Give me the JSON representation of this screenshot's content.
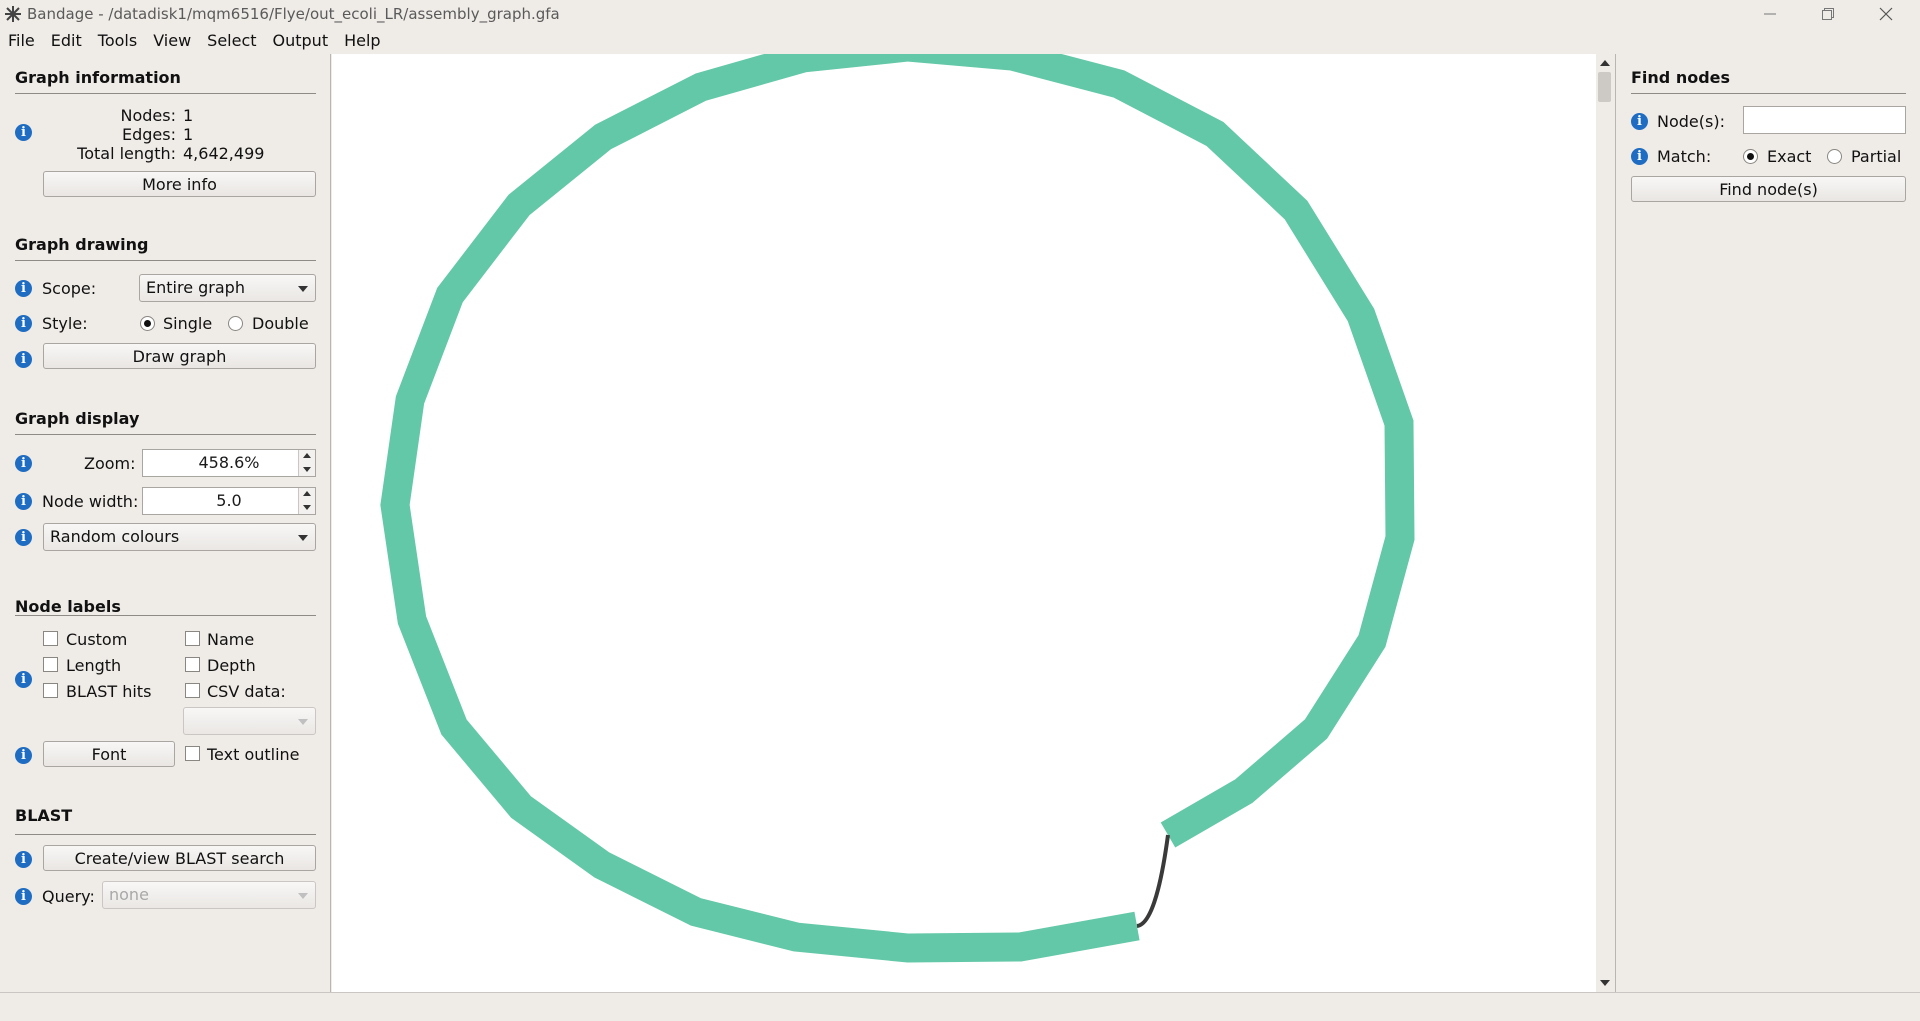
{
  "window": {
    "title": "Bandage - /datadisk1/mqm6516/Flye/out_ecoli_LR/assembly_graph.gfa"
  },
  "menu": [
    "File",
    "Edit",
    "Tools",
    "View",
    "Select",
    "Output",
    "Help"
  ],
  "graph_information": {
    "heading": "Graph information",
    "nodes_label": "Nodes:",
    "nodes_value": "1",
    "edges_label": "Edges:",
    "edges_value": "1",
    "total_length_label": "Total length:",
    "total_length_value": "4,642,499",
    "more_info_button": "More info"
  },
  "graph_drawing": {
    "heading": "Graph drawing",
    "scope_label": "Scope:",
    "scope_value": "Entire graph",
    "style_label": "Style:",
    "style_single": "Single",
    "style_double": "Double",
    "style_selected": "Single",
    "draw_button": "Draw graph"
  },
  "graph_display": {
    "heading": "Graph display",
    "zoom_label": "Zoom:",
    "zoom_value": "458.6%",
    "node_width_label": "Node width:",
    "node_width_value": "5.0",
    "colour_scheme": "Random colours"
  },
  "node_labels": {
    "heading": "Node labels",
    "custom": "Custom",
    "name": "Name",
    "length": "Length",
    "depth": "Depth",
    "blast_hits": "BLAST hits",
    "csv_data": "CSV data:",
    "font_button": "Font",
    "text_outline": "Text outline"
  },
  "blast": {
    "heading": "BLAST",
    "create_button": "Create/view BLAST search",
    "query_label": "Query:",
    "query_value": "none"
  },
  "find_nodes": {
    "heading": "Find nodes",
    "nodes_label": "Node(s):",
    "nodes_value": "",
    "match_label": "Match:",
    "match_exact": "Exact",
    "match_partial": "Partial",
    "match_selected": "Exact",
    "find_button": "Find node(s)"
  },
  "graph": {
    "node_colour": "#63c8a7",
    "edge_colour": "#3a3a3a"
  }
}
